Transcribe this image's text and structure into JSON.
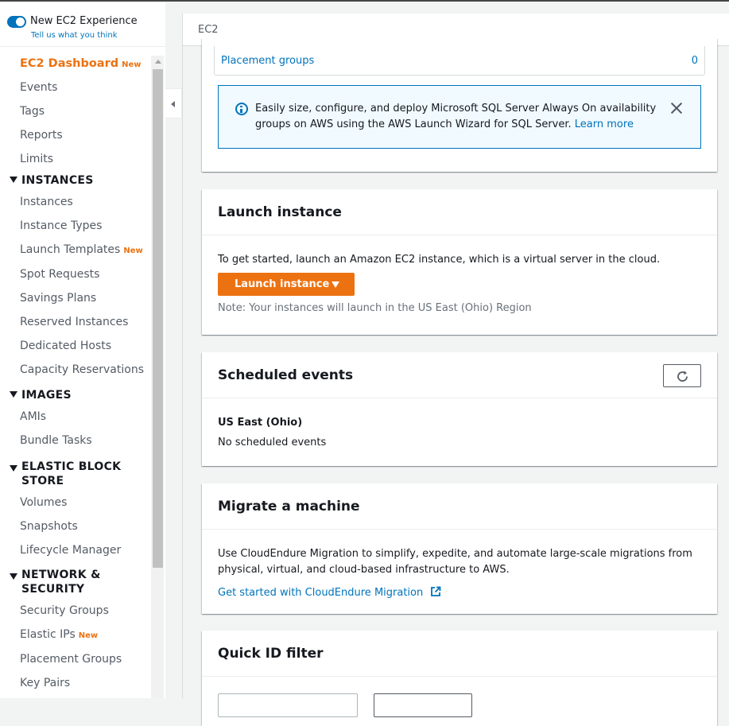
{
  "sidebar": {
    "experience_label": "New EC2 Experience",
    "feedback_link": "Tell us what you think",
    "new_badge": "New",
    "items": {
      "dashboard": "EC2 Dashboard",
      "events": "Events",
      "tags": "Tags",
      "reports": "Reports",
      "limits": "Limits"
    },
    "sections": {
      "instances": {
        "title": "INSTANCES",
        "items": [
          "Instances",
          "Instance Types",
          "Launch Templates",
          "Spot Requests",
          "Savings Plans",
          "Reserved Instances",
          "Dedicated Hosts",
          "Capacity Reservations"
        ]
      },
      "images": {
        "title": "IMAGES",
        "items": [
          "AMIs",
          "Bundle Tasks"
        ]
      },
      "ebs": {
        "title_line1": "ELASTIC BLOCK",
        "title_line2": "STORE",
        "items": [
          "Volumes",
          "Snapshots",
          "Lifecycle Manager"
        ]
      },
      "network": {
        "title_line1": "NETWORK &",
        "title_line2": "SECURITY",
        "items": [
          "Security Groups",
          "Elastic IPs",
          "Placement Groups",
          "Key Pairs"
        ]
      }
    }
  },
  "header": {
    "breadcrumb": "EC2"
  },
  "resources": {
    "placement_groups_label": "Placement groups",
    "placement_groups_count": "0"
  },
  "info_banner": {
    "text": "Easily size, configure, and deploy Microsoft SQL Server Always On availability groups on AWS using the AWS Launch Wizard for SQL Server.",
    "link": "Learn more"
  },
  "launch": {
    "title": "Launch instance",
    "description": "To get started, launch an Amazon EC2 instance, which is a virtual server in the cloud.",
    "button": "Launch instance",
    "note": "Note: Your instances will launch in the US East (Ohio) Region"
  },
  "scheduled": {
    "title": "Scheduled events",
    "region": "US East (Ohio)",
    "status": "No scheduled events"
  },
  "migrate": {
    "title": "Migrate a machine",
    "description": "Use CloudEndure Migration to simplify, expedite, and automate large-scale migrations from physical, virtual, and cloud-based infrastructure to AWS.",
    "link": "Get started with CloudEndure Migration"
  },
  "quick_id": {
    "title": "Quick ID filter"
  },
  "colors": {
    "accent": "#ec7211",
    "link": "#0073bb",
    "info_bg": "#f1faff"
  }
}
